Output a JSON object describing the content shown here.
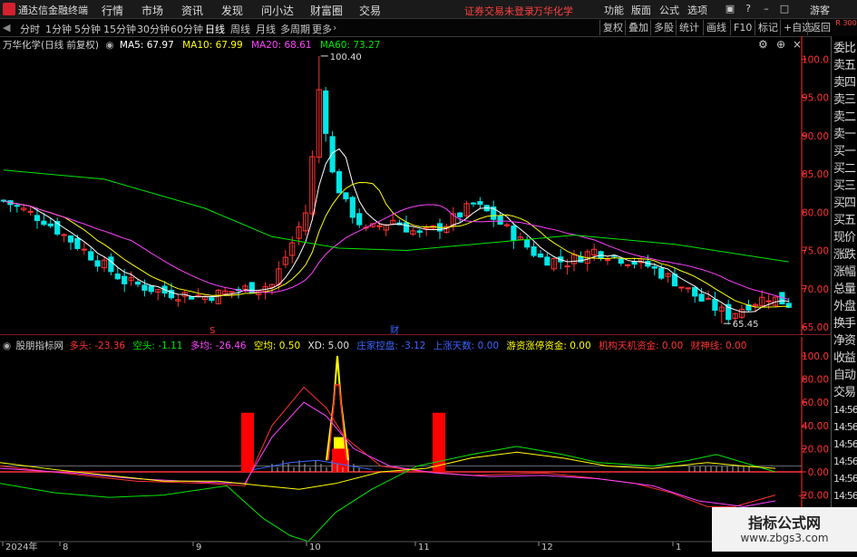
{
  "app": {
    "title": "通达信金融终端",
    "menus": [
      "行情",
      "市场",
      "资讯",
      "发现",
      "问小达",
      "财富圈",
      "交易"
    ],
    "login_status": "证券交易未登录",
    "stock_name": "万华化学",
    "right_menus": [
      "功能",
      "版面",
      "公式",
      "选项"
    ],
    "guest": "游客"
  },
  "period_tabs": [
    "分时",
    "1分钟",
    "5分钟",
    "15分钟",
    "30分钟",
    "60分钟",
    "日线",
    "周线",
    "月线",
    "多周期",
    "更多"
  ],
  "active_period": "日线",
  "chart_tools": [
    "复权",
    "叠加",
    "多股",
    "统计",
    "画线",
    "F10",
    "标记",
    "+自选",
    "返回"
  ],
  "side_panel": {
    "top_label": "R 300",
    "items": [
      "委比",
      "卖五",
      "卖四",
      "卖三",
      "卖二",
      "卖一",
      "买一",
      "买二",
      "买三",
      "买四",
      "买五",
      "现价",
      "涨跌",
      "涨幅",
      "总量",
      "外盘",
      "换手",
      "净资",
      "收益",
      "自动",
      "交易",
      "14:56",
      "14:56",
      "14:56",
      "14:56",
      "14:56",
      "14:56",
      "14:56",
      "14:56",
      "14:56"
    ]
  },
  "main_info": {
    "title": "万华化学(日线 前复权)",
    "ma": [
      {
        "label": "MA5: 67.97",
        "color": "#ffffff"
      },
      {
        "label": "MA10: 67.99",
        "color": "#ffff00"
      },
      {
        "label": "MA20: 68.61",
        "color": "#ff40ff"
      },
      {
        "label": "MA60: 73.27",
        "color": "#00e600"
      }
    ]
  },
  "sub_info": {
    "title": "股朋指标网",
    "items": [
      {
        "label": "多头: -23.36",
        "color": "#ff3232"
      },
      {
        "label": "空头: -1.11",
        "color": "#00e600"
      },
      {
        "label": "多均: -26.46",
        "color": "#ff40ff"
      },
      {
        "label": "空均: 0.50",
        "color": "#ffff00"
      },
      {
        "label": "XD: 5.00",
        "color": "#e0e0e0"
      },
      {
        "label": "庄家控盘: -3.12",
        "color": "#3c64ff"
      },
      {
        "label": "上涨天数: 0.00",
        "color": "#3c64ff"
      },
      {
        "label": "游资涨停资金: 0.00",
        "color": "#ffff00"
      },
      {
        "label": "机构天机资金: 0.00",
        "color": "#ff3232"
      },
      {
        "label": "财神线: 0.00",
        "color": "#ff3232"
      }
    ]
  },
  "markers": {
    "s": "S",
    "cai": "财"
  },
  "chart_data": [
    {
      "type": "candlestick",
      "title": "万华化学(日线 前复权)",
      "ylim": [
        64,
        103
      ],
      "yticks": [
        "100.0",
        "95.00",
        "90.00",
        "85.00",
        "80.00",
        "75.00",
        "70.00",
        "65.00"
      ],
      "x_labels": [
        "2024年",
        "8",
        "9",
        "10",
        "11",
        "12",
        "1"
      ],
      "annotations": {
        "high": "100.40",
        "low": "65.45"
      },
      "ma_legend": [
        "MA5: 67.97",
        "MA10: 67.99",
        "MA20: 68.61",
        "MA60: 73.27"
      ],
      "colors": {
        "up": "#ff3232",
        "down": "#00e6e6",
        "ma5": "#ffffff",
        "ma10": "#ffff00",
        "ma20": "#ff40ff",
        "ma60": "#00e600"
      }
    },
    {
      "type": "line",
      "title": "股朋指标网",
      "ylim": [
        -25,
        110
      ],
      "yticks": [
        "100.0",
        "80.00",
        "60.00",
        "40.00",
        "20.00",
        "0.00",
        "-20.00"
      ],
      "series_labels": [
        "多头",
        "空头",
        "多均",
        "空均",
        "XD",
        "庄家控盘",
        "上涨天数",
        "游资涨停资金",
        "机构天机资金",
        "财神线"
      ]
    }
  ],
  "watermark": {
    "line1": "指标公式网",
    "line2": "www.zbgs3.com"
  }
}
